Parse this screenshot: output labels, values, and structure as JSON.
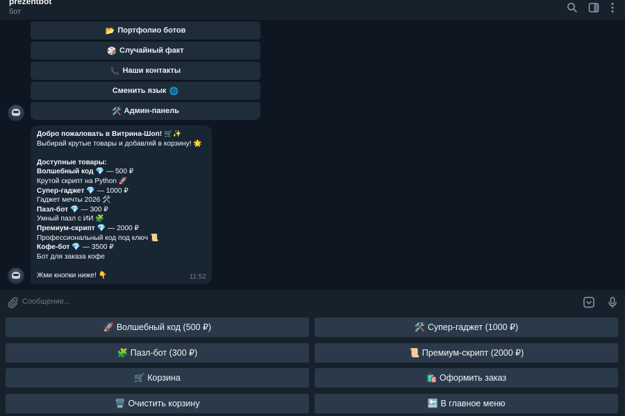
{
  "header": {
    "title": "prezentbot",
    "subtitle": "бот",
    "icons": [
      "search-icon",
      "sidebar-toggle-icon",
      "more-icon"
    ]
  },
  "inline_keyboard": [
    {
      "emoji": "📂",
      "label": "Портфолио ботов"
    },
    {
      "emoji": "🎲",
      "label": "Случайный факт"
    },
    {
      "emoji": "📞",
      "label": "Наши контакты"
    },
    {
      "emoji_after": "🌐",
      "label": "Сменить язык"
    },
    {
      "emoji": "🛠️",
      "label": "Админ-панель"
    }
  ],
  "message": {
    "greeting": "Добро пожаловать в Витрина-Шоп! 🛒✨",
    "intro": "Выбирай крутые товары и добавляй в корзину! 🌟",
    "products_title": "Доступные товары:",
    "products": [
      {
        "name": "Волшебный код",
        "gem": "💎",
        "price": "— 500 ₽",
        "desc": "Крутой скрипт на Python 🚀"
      },
      {
        "name": "Супер-гаджет",
        "gem": "💎",
        "price": "— 1000 ₽",
        "desc": "Гаджет мечты 2026 🛠️"
      },
      {
        "name": "Пазл-бот",
        "gem": "💎",
        "price": "— 300 ₽",
        "desc": "Умный пазл с ИИ 🧩"
      },
      {
        "name": "Премиум-скрипт",
        "gem": "💎",
        "price": "— 2000 ₽",
        "desc": "Профессиональный код под ключ 📜"
      },
      {
        "name": "Кофе-бот",
        "gem": "💎",
        "price": "— 3500 ₽",
        "desc": "Бот для заказа кофе"
      }
    ],
    "footer": "Жми кнопки ниже! 👇",
    "time": "11:52"
  },
  "composer": {
    "placeholder": "Сообщение..."
  },
  "reply_keyboard": [
    {
      "label": "🚀 Волшебный код (500 ₽)"
    },
    {
      "label": "🛠️ Супер-гаджет (1000 ₽)"
    },
    {
      "label": "🧩 Пазл-бот (300 ₽)"
    },
    {
      "label": "📜 Премиум-скрипт (2000 ₽)"
    },
    {
      "label": "🛒 Корзина"
    },
    {
      "label": "🛍️ Оформить заказ"
    },
    {
      "label": "🗑️ Очистить корзину"
    },
    {
      "label": "🔙 В главное меню"
    }
  ],
  "colors": {
    "chat_bg": "#0e1621",
    "panel_bg": "#17212b",
    "bubble_bg": "#182533",
    "inline_button_bg": "#1f2d3a",
    "reply_button_bg": "#2b3a4a",
    "secondary_text": "#7f91a4"
  }
}
